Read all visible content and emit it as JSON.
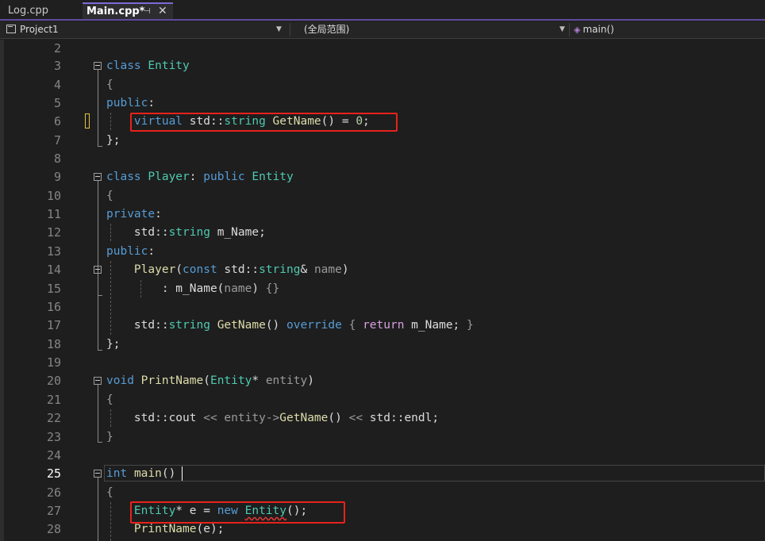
{
  "tabs": [
    {
      "label": "Log.cpp",
      "active": false
    },
    {
      "label": "Main.cpp*",
      "active": true,
      "pin_glyph": "⊣",
      "close_glyph": "✕"
    }
  ],
  "navbar": {
    "project": "Project1",
    "scope": "(全局范围)",
    "member": "main()"
  },
  "editor": {
    "current_line": 25,
    "line_numbers": [
      "2",
      "3",
      "4",
      "5",
      "6",
      "7",
      "8",
      "9",
      "10",
      "11",
      "12",
      "13",
      "14",
      "15",
      "16",
      "17",
      "18",
      "19",
      "20",
      "21",
      "22",
      "23",
      "24",
      "25",
      "26",
      "27",
      "28"
    ]
  },
  "highlights": [
    {
      "line": 6,
      "text": "virtual std::string GetName() = 0;"
    },
    {
      "line": 27,
      "text": "Entity* e = new Entity();"
    }
  ],
  "colors": {
    "keyword": "#569cd6",
    "type": "#4ec9b0",
    "function": "#dcdcaa",
    "control": "#d8a0df",
    "highlight_box": "#e8221b",
    "accent": "#5f4ba1"
  }
}
